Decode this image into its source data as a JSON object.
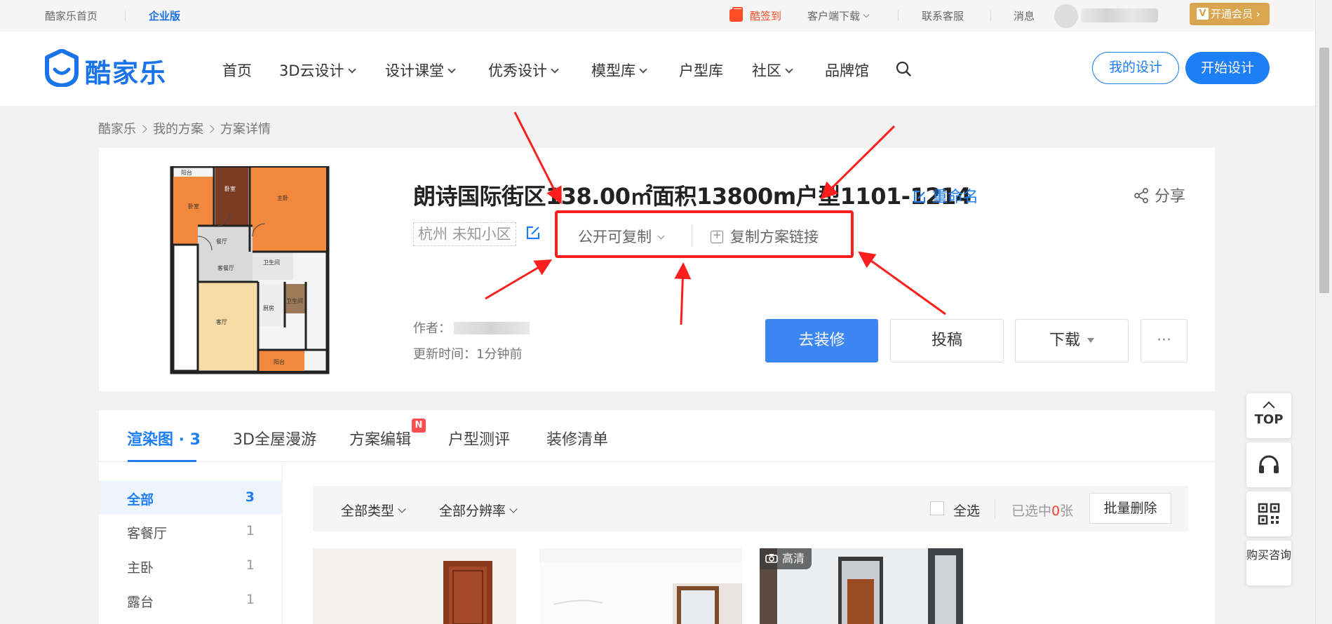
{
  "topbar": {
    "home_link": "酷家乐首页",
    "enterprise": "企业版",
    "signin": "酷签到",
    "download": "客户端下载",
    "support": "联系客服",
    "messages": "消息",
    "vip": "开通会员 ›"
  },
  "nav": {
    "logo": "酷家乐",
    "items": [
      "首页",
      "3D云设计",
      "设计课堂",
      "优秀设计",
      "模型库",
      "户型库",
      "社区",
      "品牌馆"
    ],
    "my_design": "我的设计",
    "start_design": "开始设计"
  },
  "breadcrumb": [
    "酷家乐",
    "我的方案",
    "方案详情"
  ],
  "plan": {
    "title": "朗诗国际街区138.00㎡面积13800m户型1101-1214",
    "rename": "重命名",
    "share": "分享",
    "location": "杭州 未知小区",
    "permission": "公开可复制",
    "copy_link": "复制方案链接",
    "author_label": "作者：",
    "updated": "更新时间：1分钟前",
    "btn_decorate": "去装修",
    "btn_submit": "投稿",
    "btn_download": "下载",
    "btn_more": "···",
    "floorplan_rooms": [
      "阳台",
      "卧室",
      "主卧",
      "餐厅",
      "卫生间",
      "客餐厅",
      "客厅",
      "厨房",
      "卫生间"
    ]
  },
  "tabs": {
    "items": [
      "渲染图 · 3",
      "3D全屋漫游",
      "方案编辑",
      "户型测评",
      "装修清单"
    ],
    "new_badge": "N"
  },
  "sidebar": {
    "items": [
      {
        "label": "全部",
        "count": "3"
      },
      {
        "label": "客餐厅",
        "count": "1"
      },
      {
        "label": "主卧",
        "count": "1"
      },
      {
        "label": "露台",
        "count": "1"
      }
    ]
  },
  "filters": {
    "type": "全部类型",
    "resolution": "全部分辨率",
    "select_all": "全选",
    "selected_prefix": "已选中",
    "selected_count": "0",
    "selected_suffix": "张",
    "batch_delete": "批量删除"
  },
  "gallery": {
    "hd_tag": "高清"
  },
  "tools": {
    "top": "TOP",
    "buy": "购买咨询"
  },
  "colors": {
    "accent": "#1e7ef5",
    "annotation": "#ff1e1e",
    "vip": "#d9a64f"
  }
}
